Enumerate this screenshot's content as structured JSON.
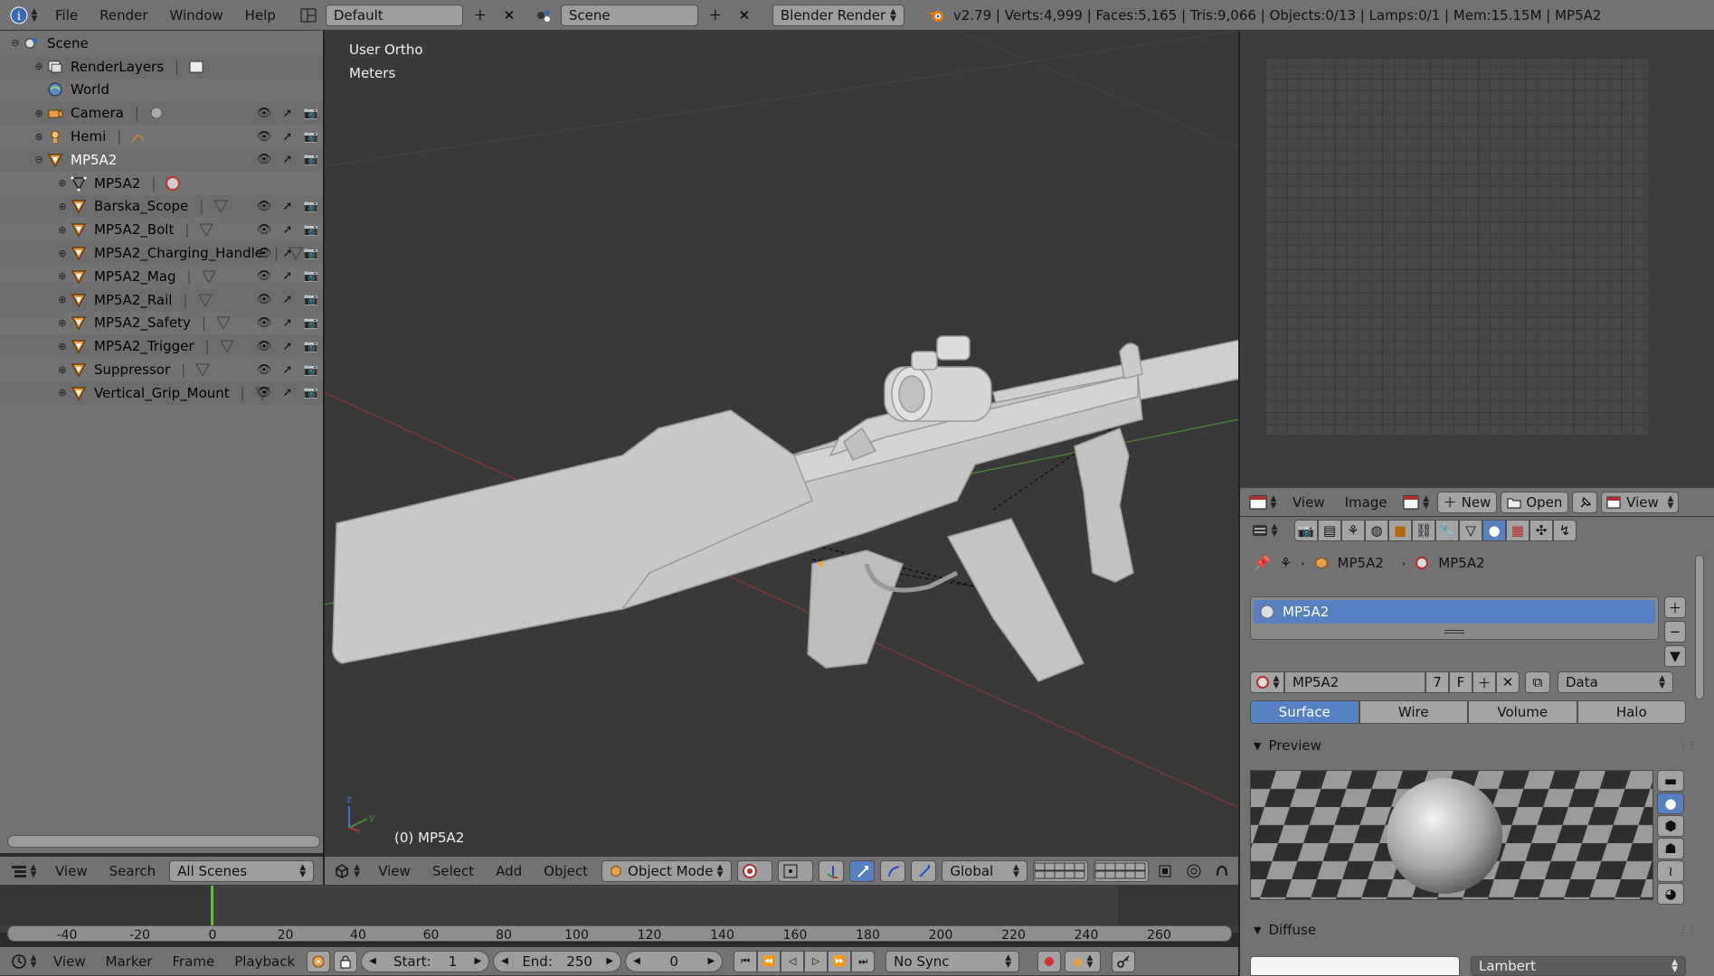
{
  "topbar": {
    "menus": [
      "File",
      "Render",
      "Window",
      "Help"
    ],
    "screen_layout": "Default",
    "scene": "Scene",
    "engine": "Blender Render",
    "stats": "v2.79 | Verts:4,999 | Faces:5,165 | Tris:9,066 | Objects:0/13 | Lamps:0/1 | Mem:15.15M | MP5A2"
  },
  "outliner": {
    "rows": [
      {
        "label": "Scene",
        "icon": "scene-icon",
        "level": 0,
        "toggles": false
      },
      {
        "label": "RenderLayers",
        "icon": "render-layers-icon",
        "level": 1,
        "toggles": false
      },
      {
        "label": "World",
        "icon": "world-icon",
        "level": 1,
        "toggles": false
      },
      {
        "label": "Camera",
        "icon": "camera-icon",
        "level": 1,
        "toggles": true
      },
      {
        "label": "Hemi",
        "icon": "lamp-icon",
        "level": 1,
        "toggles": true
      },
      {
        "label": "MP5A2",
        "icon": "mesh-object-icon",
        "level": 1,
        "toggles": true,
        "active": true
      },
      {
        "label": "MP5A2",
        "icon": "mesh-data-icon",
        "level": 2,
        "toggles": false
      },
      {
        "label": "Barska_Scope",
        "icon": "mesh-object-icon",
        "level": 2,
        "toggles": true
      },
      {
        "label": "MP5A2_Bolt",
        "icon": "mesh-object-icon",
        "level": 2,
        "toggles": true
      },
      {
        "label": "MP5A2_Charging_Handle",
        "icon": "mesh-object-icon",
        "level": 2,
        "toggles": true
      },
      {
        "label": "MP5A2_Mag",
        "icon": "mesh-object-icon",
        "level": 2,
        "toggles": true
      },
      {
        "label": "MP5A2_Rail",
        "icon": "mesh-object-icon",
        "level": 2,
        "toggles": true
      },
      {
        "label": "MP5A2_Safety",
        "icon": "mesh-object-icon",
        "level": 2,
        "toggles": true
      },
      {
        "label": "MP5A2_Trigger",
        "icon": "mesh-object-icon",
        "level": 2,
        "toggles": true
      },
      {
        "label": "Suppressor",
        "icon": "mesh-object-icon",
        "level": 2,
        "toggles": true
      },
      {
        "label": "Vertical_Grip_Mount",
        "icon": "mesh-object-icon",
        "level": 2,
        "toggles": true
      }
    ],
    "footer": {
      "view": "View",
      "search": "Search",
      "filter": "All Scenes"
    }
  },
  "viewport": {
    "projection": "User Ortho",
    "units": "Meters",
    "object_label": "(0) MP5A2",
    "header": {
      "menus": [
        "View",
        "Select",
        "Add",
        "Object"
      ],
      "mode": "Object Mode",
      "orientation": "Global"
    }
  },
  "image_editor": {
    "header": {
      "view": "View",
      "image": "Image",
      "new": "New",
      "open": "Open",
      "view2": "View"
    }
  },
  "properties": {
    "breadcrumb": [
      "MP5A2",
      "MP5A2"
    ],
    "material_slot": "MP5A2",
    "material_name": "MP5A2",
    "users": "7",
    "fake_user": "F",
    "link": "Data",
    "tabs": [
      "Surface",
      "Wire",
      "Volume",
      "Halo"
    ],
    "active_tab": "Surface",
    "preview_title": "Preview",
    "diffuse_title": "Diffuse",
    "diffuse_shader": "Lambert"
  },
  "timeline": {
    "ticks": [
      "-40",
      "-20",
      "0",
      "20",
      "40",
      "60",
      "80",
      "100",
      "120",
      "140",
      "160",
      "180",
      "200",
      "220",
      "240",
      "260"
    ],
    "current_frame": 0,
    "menus": [
      "View",
      "Marker",
      "Frame",
      "Playback"
    ],
    "start_label": "Start:",
    "start": "1",
    "end_label": "End:",
    "end": "250",
    "frame": "0",
    "sync": "No Sync"
  },
  "colors": {
    "header": "#727272",
    "viewport_bg": "#393939",
    "active_blue": "#5680c2",
    "active_text": "#ffffff"
  }
}
